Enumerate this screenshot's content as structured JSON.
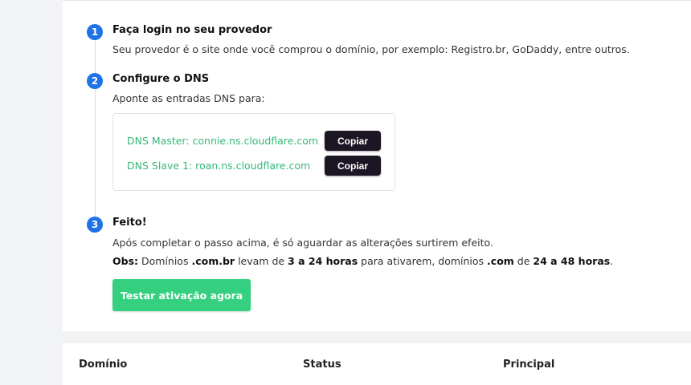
{
  "steps": [
    {
      "number": "1",
      "title": "Faça login no seu provedor",
      "text": "Seu provedor é o site onde você comprou o domínio, por exemplo: Registro.br, GoDaddy, entre outros."
    },
    {
      "number": "2",
      "title": "Configure o DNS",
      "text": "Aponte as entradas DNS para:"
    },
    {
      "number": "3",
      "title": "Feito!",
      "text": "Após completar o passo acima, é só aguardar as alterações surtirem efeito."
    }
  ],
  "dns": [
    {
      "label": "DNS Master: connie.ns.cloudflare.com",
      "button": "Copiar"
    },
    {
      "label": "DNS Slave 1: roan.ns.cloudflare.com",
      "button": "Copiar"
    }
  ],
  "obs": {
    "label": "Obs:",
    "t1": " Domínios ",
    "b1": ".com.br",
    "t2": " levam de ",
    "b2": "3 a 24 horas",
    "t3": " para ativarem, domínios ",
    "b3": ".com",
    "t4": " de ",
    "b4": "24 a 48 horas",
    "t5": "."
  },
  "test_button": "Testar ativação agora",
  "table": {
    "headers": [
      "Domínio",
      "Status",
      "Principal"
    ]
  },
  "colors": {
    "step_badge": "#1e73e6",
    "dns_text": "#35b877",
    "copy_button": "#1c1524",
    "test_button": "#34d07f"
  }
}
